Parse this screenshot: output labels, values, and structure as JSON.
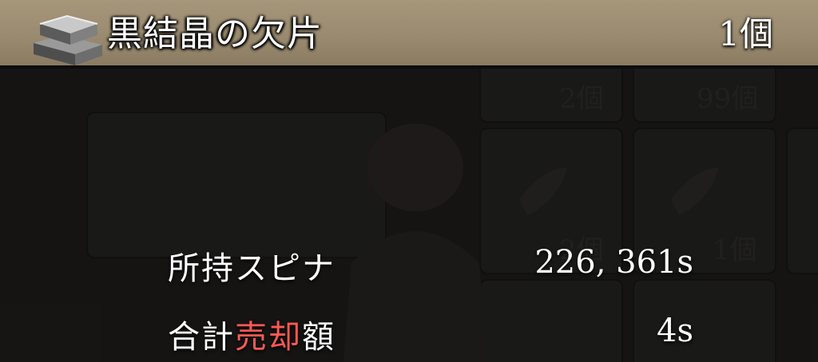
{
  "header": {
    "icon": "black-crystal-ingot-icon",
    "item_name": "黒結晶の欠片",
    "item_count": "1個"
  },
  "info": {
    "owned_label": "所持スピナ",
    "owned_value": "226, 361s",
    "total_label_prefix": "合計",
    "total_label_highlight": "売却",
    "total_label_suffix": "額",
    "total_value": "4s"
  },
  "background": {
    "counts": [
      "2個",
      "99個",
      "2個",
      "1個"
    ]
  },
  "colors": {
    "header_bar": "#9a8b70",
    "highlight_red": "#ff5a52",
    "text": "#ffffff"
  }
}
